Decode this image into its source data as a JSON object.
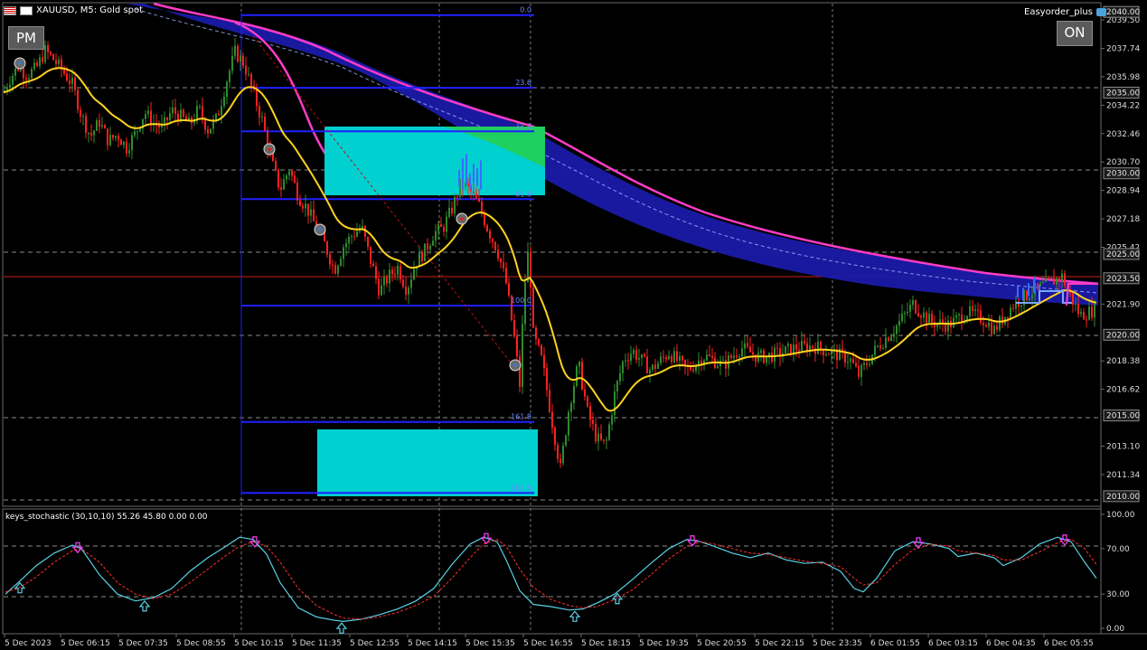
{
  "window": {
    "symbol_title": "XAUUSD, M5:  Gold spot",
    "ea_name": "Easyorder_plus",
    "pm_button": "PM",
    "on_button": "ON"
  },
  "price_axis": {
    "labels": [
      "2039.50",
      "2037.74",
      "2035.98",
      "2034.22",
      "2032.46",
      "2030.70",
      "2028.94",
      "2027.18",
      "2025.42",
      "2021.90",
      "2018.38",
      "2016.62",
      "2013.10",
      "2011.34"
    ],
    "level_labels": [
      "2040.00",
      "2035.00",
      "2030.00",
      "2025.00",
      "2023.50",
      "2020.00",
      "2015.00",
      "2010.00"
    ]
  },
  "time_axis": {
    "labels": [
      "5 Dec 2023",
      "5 Dec 06:15",
      "5 Dec 07:35",
      "5 Dec 08:55",
      "5 Dec 10:15",
      "5 Dec 11:35",
      "5 Dec 12:55",
      "5 Dec 14:15",
      "5 Dec 15:35",
      "5 Dec 16:55",
      "5 Dec 18:15",
      "5 Dec 19:35",
      "5 Dec 20:55",
      "5 Dec 22:15",
      "5 Dec 23:35",
      "6 Dec 01:55",
      "6 Dec 03:15",
      "6 Dec 04:35",
      "6 Dec 05:55"
    ]
  },
  "fib_levels": [
    {
      "label": "0.0",
      "price": 2039.8
    },
    {
      "label": "23.6",
      "price": 2035.3
    },
    {
      "label": "38.2",
      "price": 2032.6
    },
    {
      "label": "61.8",
      "price": 2028.4
    },
    {
      "label": "100.0",
      "price": 2021.8
    },
    {
      "label": "161.8",
      "price": 2014.6
    },
    {
      "label": "161.8",
      "price": 2010.2
    }
  ],
  "indicator": {
    "label": "keys_stochastic (30,10,10) 55.26 45.80 0.00 0.00",
    "axis_labels": [
      "100.00",
      "70.00",
      "30.00",
      "0.00"
    ]
  },
  "colors": {
    "bull": "#2e8b2e",
    "bear": "#ff2020",
    "ma_yellow": "#ffd21f",
    "band_blue": "#1a1aa8",
    "band_pink": "#ff3cc8",
    "zone_cyan": "#00d0d0",
    "fib_line": "#2020ff",
    "level_red": "#c82020"
  },
  "chart_data": {
    "type": "candlestick",
    "title": "",
    "y_range": [
      2009.6,
      2040.4
    ],
    "stochastic_range": [
      0,
      100
    ],
    "close_path": [
      [
        0,
        2034.5
      ],
      [
        10,
        2035.8
      ],
      [
        20,
        2036.6
      ],
      [
        30,
        2036.1
      ],
      [
        40,
        2036.5
      ],
      [
        50,
        2037.6
      ],
      [
        60,
        2037.0
      ],
      [
        70,
        2036.3
      ],
      [
        80,
        2035.5
      ],
      [
        90,
        2033.6
      ],
      [
        100,
        2032.3
      ],
      [
        110,
        2033.2
      ],
      [
        120,
        2032.0
      ],
      [
        130,
        2032.4
      ],
      [
        140,
        2031.6
      ],
      [
        150,
        2032.5
      ],
      [
        160,
        2033.8
      ],
      [
        170,
        2033.1
      ],
      [
        180,
        2032.8
      ],
      [
        190,
        2033.9
      ],
      [
        200,
        2033.5
      ],
      [
        210,
        2033.0
      ],
      [
        220,
        2034.0
      ],
      [
        230,
        2032.7
      ],
      [
        240,
        2033.4
      ],
      [
        250,
        2035.6
      ],
      [
        260,
        2037.5
      ],
      [
        270,
        2036.8
      ],
      [
        280,
        2035.0
      ],
      [
        290,
        2033.3
      ],
      [
        300,
        2030.8
      ],
      [
        310,
        2029.0
      ],
      [
        320,
        2030.3
      ],
      [
        330,
        2028.6
      ],
      [
        340,
        2027.8
      ],
      [
        350,
        2026.6
      ],
      [
        360,
        2025.5
      ],
      [
        370,
        2024.0
      ],
      [
        380,
        2025.5
      ],
      [
        390,
        2026.2
      ],
      [
        400,
        2026.7
      ],
      [
        410,
        2024.6
      ],
      [
        420,
        2022.7
      ],
      [
        430,
        2023.6
      ],
      [
        440,
        2024.2
      ],
      [
        450,
        2022.8
      ],
      [
        460,
        2024.5
      ],
      [
        470,
        2025.2
      ],
      [
        480,
        2026.3
      ],
      [
        490,
        2026.6
      ],
      [
        500,
        2027.8
      ],
      [
        510,
        2029.4
      ],
      [
        520,
        2028.9
      ],
      [
        530,
        2028.0
      ],
      [
        540,
        2026.5
      ],
      [
        550,
        2025.3
      ],
      [
        560,
        2023.2
      ],
      [
        570,
        2019.4
      ],
      [
        575,
        2016.9
      ],
      [
        580,
        2022.8
      ],
      [
        585,
        2025.5
      ],
      [
        590,
        2020.0
      ],
      [
        600,
        2018.3
      ],
      [
        610,
        2014.9
      ],
      [
        620,
        2011.7
      ],
      [
        630,
        2015.7
      ],
      [
        640,
        2018.2
      ],
      [
        650,
        2015.2
      ],
      [
        660,
        2013.6
      ],
      [
        670,
        2013.1
      ],
      [
        680,
        2016.3
      ],
      [
        690,
        2018.5
      ],
      [
        700,
        2019.0
      ],
      [
        720,
        2017.8
      ],
      [
        740,
        2018.9
      ],
      [
        760,
        2017.8
      ],
      [
        780,
        2018.7
      ],
      [
        800,
        2018.1
      ],
      [
        820,
        2019.2
      ],
      [
        840,
        2018.6
      ],
      [
        860,
        2018.8
      ],
      [
        880,
        2019.2
      ],
      [
        900,
        2019.3
      ],
      [
        920,
        2018.9
      ],
      [
        940,
        2018.5
      ],
      [
        950,
        2017.5
      ],
      [
        970,
        2019.2
      ],
      [
        990,
        2020.4
      ],
      [
        1010,
        2021.9
      ],
      [
        1030,
        2020.8
      ],
      [
        1050,
        2020.6
      ],
      [
        1070,
        2021.4
      ],
      [
        1090,
        2020.9
      ],
      [
        1100,
        2020.3
      ],
      [
        1120,
        2021.8
      ],
      [
        1140,
        2022.6
      ],
      [
        1160,
        2023.2
      ],
      [
        1175,
        2023.6
      ],
      [
        1185,
        2022.3
      ],
      [
        1195,
        2021.2
      ],
      [
        1213,
        2021.6
      ]
    ],
    "stochastic_main": [
      [
        6,
        30
      ],
      [
        20,
        40
      ],
      [
        40,
        55
      ],
      [
        60,
        66
      ],
      [
        80,
        73
      ],
      [
        90,
        70
      ],
      [
        110,
        47
      ],
      [
        130,
        30
      ],
      [
        150,
        24
      ],
      [
        170,
        27
      ],
      [
        190,
        35
      ],
      [
        210,
        50
      ],
      [
        230,
        62
      ],
      [
        250,
        72
      ],
      [
        265,
        80
      ],
      [
        280,
        78
      ],
      [
        295,
        65
      ],
      [
        310,
        40
      ],
      [
        330,
        18
      ],
      [
        350,
        10
      ],
      [
        370,
        7
      ],
      [
        380,
        6
      ],
      [
        400,
        8
      ],
      [
        420,
        12
      ],
      [
        440,
        17
      ],
      [
        460,
        24
      ],
      [
        480,
        35
      ],
      [
        500,
        56
      ],
      [
        520,
        74
      ],
      [
        535,
        80
      ],
      [
        550,
        76
      ],
      [
        560,
        60
      ],
      [
        575,
        33
      ],
      [
        590,
        21
      ],
      [
        610,
        19
      ],
      [
        630,
        16
      ],
      [
        645,
        17
      ],
      [
        660,
        22
      ],
      [
        680,
        30
      ],
      [
        700,
        43
      ],
      [
        720,
        57
      ],
      [
        740,
        70
      ],
      [
        760,
        78
      ],
      [
        775,
        76
      ],
      [
        790,
        72
      ],
      [
        810,
        66
      ],
      [
        830,
        62
      ],
      [
        850,
        66
      ],
      [
        870,
        60
      ],
      [
        890,
        57
      ],
      [
        910,
        58
      ],
      [
        930,
        50
      ],
      [
        945,
        35
      ],
      [
        955,
        32
      ],
      [
        970,
        44
      ],
      [
        990,
        68
      ],
      [
        1010,
        76
      ],
      [
        1030,
        74
      ],
      [
        1050,
        70
      ],
      [
        1060,
        63
      ],
      [
        1080,
        66
      ],
      [
        1100,
        62
      ],
      [
        1110,
        55
      ],
      [
        1130,
        62
      ],
      [
        1150,
        74
      ],
      [
        1170,
        80
      ],
      [
        1185,
        76
      ],
      [
        1200,
        58
      ],
      [
        1213,
        44
      ]
    ],
    "stochastic_signal": [
      [
        6,
        32
      ],
      [
        20,
        35
      ],
      [
        40,
        45
      ],
      [
        60,
        58
      ],
      [
        80,
        68
      ],
      [
        90,
        70
      ],
      [
        110,
        58
      ],
      [
        130,
        40
      ],
      [
        150,
        30
      ],
      [
        170,
        26
      ],
      [
        190,
        30
      ],
      [
        210,
        40
      ],
      [
        230,
        52
      ],
      [
        250,
        64
      ],
      [
        265,
        72
      ],
      [
        280,
        76
      ],
      [
        295,
        72
      ],
      [
        310,
        58
      ],
      [
        330,
        35
      ],
      [
        350,
        20
      ],
      [
        370,
        12
      ],
      [
        380,
        9
      ],
      [
        400,
        8
      ],
      [
        420,
        10
      ],
      [
        440,
        14
      ],
      [
        460,
        20
      ],
      [
        480,
        28
      ],
      [
        500,
        44
      ],
      [
        520,
        62
      ],
      [
        535,
        74
      ],
      [
        550,
        78
      ],
      [
        560,
        72
      ],
      [
        575,
        52
      ],
      [
        590,
        36
      ],
      [
        610,
        25
      ],
      [
        630,
        20
      ],
      [
        645,
        18
      ],
      [
        660,
        19
      ],
      [
        680,
        25
      ],
      [
        700,
        34
      ],
      [
        720,
        47
      ],
      [
        740,
        61
      ],
      [
        760,
        72
      ],
      [
        775,
        76
      ],
      [
        790,
        74
      ],
      [
        810,
        70
      ],
      [
        830,
        66
      ],
      [
        850,
        65
      ],
      [
        870,
        62
      ],
      [
        890,
        59
      ],
      [
        910,
        57
      ],
      [
        930,
        54
      ],
      [
        945,
        44
      ],
      [
        955,
        38
      ],
      [
        970,
        40
      ],
      [
        990,
        56
      ],
      [
        1010,
        69
      ],
      [
        1030,
        74
      ],
      [
        1050,
        72
      ],
      [
        1060,
        68
      ],
      [
        1080,
        66
      ],
      [
        1100,
        64
      ],
      [
        1110,
        60
      ],
      [
        1130,
        60
      ],
      [
        1150,
        67
      ],
      [
        1170,
        75
      ],
      [
        1185,
        78
      ],
      [
        1200,
        70
      ],
      [
        1213,
        56
      ]
    ],
    "buy_arrows_x": [
      22,
      160,
      378,
      636,
      683
    ],
    "sell_arrows_x": [
      86,
      282,
      538,
      766,
      1016,
      1178
    ]
  }
}
